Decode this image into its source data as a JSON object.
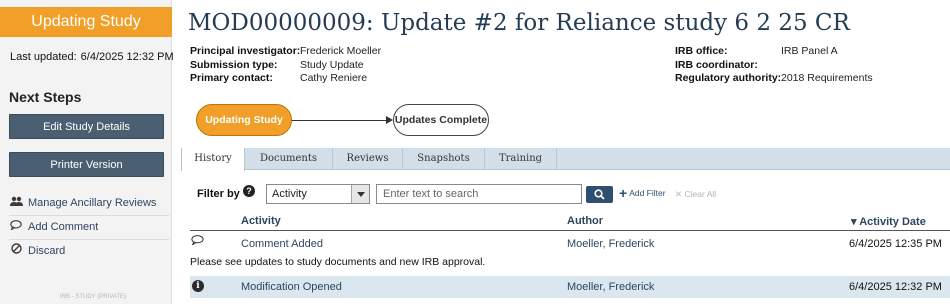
{
  "sidebar": {
    "state": "Updating Study",
    "last_updated_label": "Last updated:",
    "last_updated_value": "6/4/2025 12:32 PM",
    "next_steps_heading": "Next Steps",
    "buttons": [
      {
        "label": "Edit Study Details",
        "icon": "none"
      },
      {
        "label": "Printer Version",
        "icon": "none"
      }
    ],
    "links": [
      {
        "label": "Manage Ancillary Reviews",
        "icon": "users-icon"
      },
      {
        "label": "Add Comment",
        "icon": "comment-icon"
      },
      {
        "label": "Discard",
        "icon": "discard-icon"
      }
    ],
    "footer_tag": "IRB - STUDY (PRIVATE)"
  },
  "header": {
    "title": "MOD00000009: Update #2 for Reliance study 6 2 25 CR",
    "left_meta": [
      {
        "key": "Principal investigator:",
        "value": "Frederick Moeller"
      },
      {
        "key": "Submission type:",
        "value": "Study Update"
      },
      {
        "key": "Primary contact:",
        "value": "Cathy Reniere"
      }
    ],
    "right_meta": [
      {
        "key": "IRB office:",
        "value": "IRB Panel A"
      },
      {
        "key": "IRB coordinator:",
        "value": ""
      },
      {
        "key": "Regulatory authority:",
        "value": "2018 Requirements"
      }
    ]
  },
  "workflow": {
    "current": "Updating Study",
    "next": "Updates Complete",
    "current_color": "#f19f28"
  },
  "tabs": [
    {
      "label": "History",
      "active": true
    },
    {
      "label": "Documents",
      "active": false
    },
    {
      "label": "Reviews",
      "active": false
    },
    {
      "label": "Snapshots",
      "active": false
    },
    {
      "label": "Training",
      "active": false
    }
  ],
  "filter": {
    "label": "Filter by",
    "selected": "Activity",
    "search_placeholder": "Enter text to search",
    "add_filter": "Add Filter",
    "clear_all": "Clear All"
  },
  "table": {
    "columns": [
      "Activity",
      "Author",
      "Activity Date"
    ],
    "sort_indicator": "▾",
    "rows": [
      {
        "icon": "comment-icon",
        "activity": "Comment Added",
        "author": "Moeller, Frederick",
        "date": "6/4/2025 12:35 PM",
        "note": "Please see updates to study documents and new IRB approval."
      },
      {
        "icon": "info-icon",
        "activity": "Modification Opened",
        "author": "Moeller, Frederick",
        "date": "6/4/2025 12:32 PM"
      }
    ]
  }
}
